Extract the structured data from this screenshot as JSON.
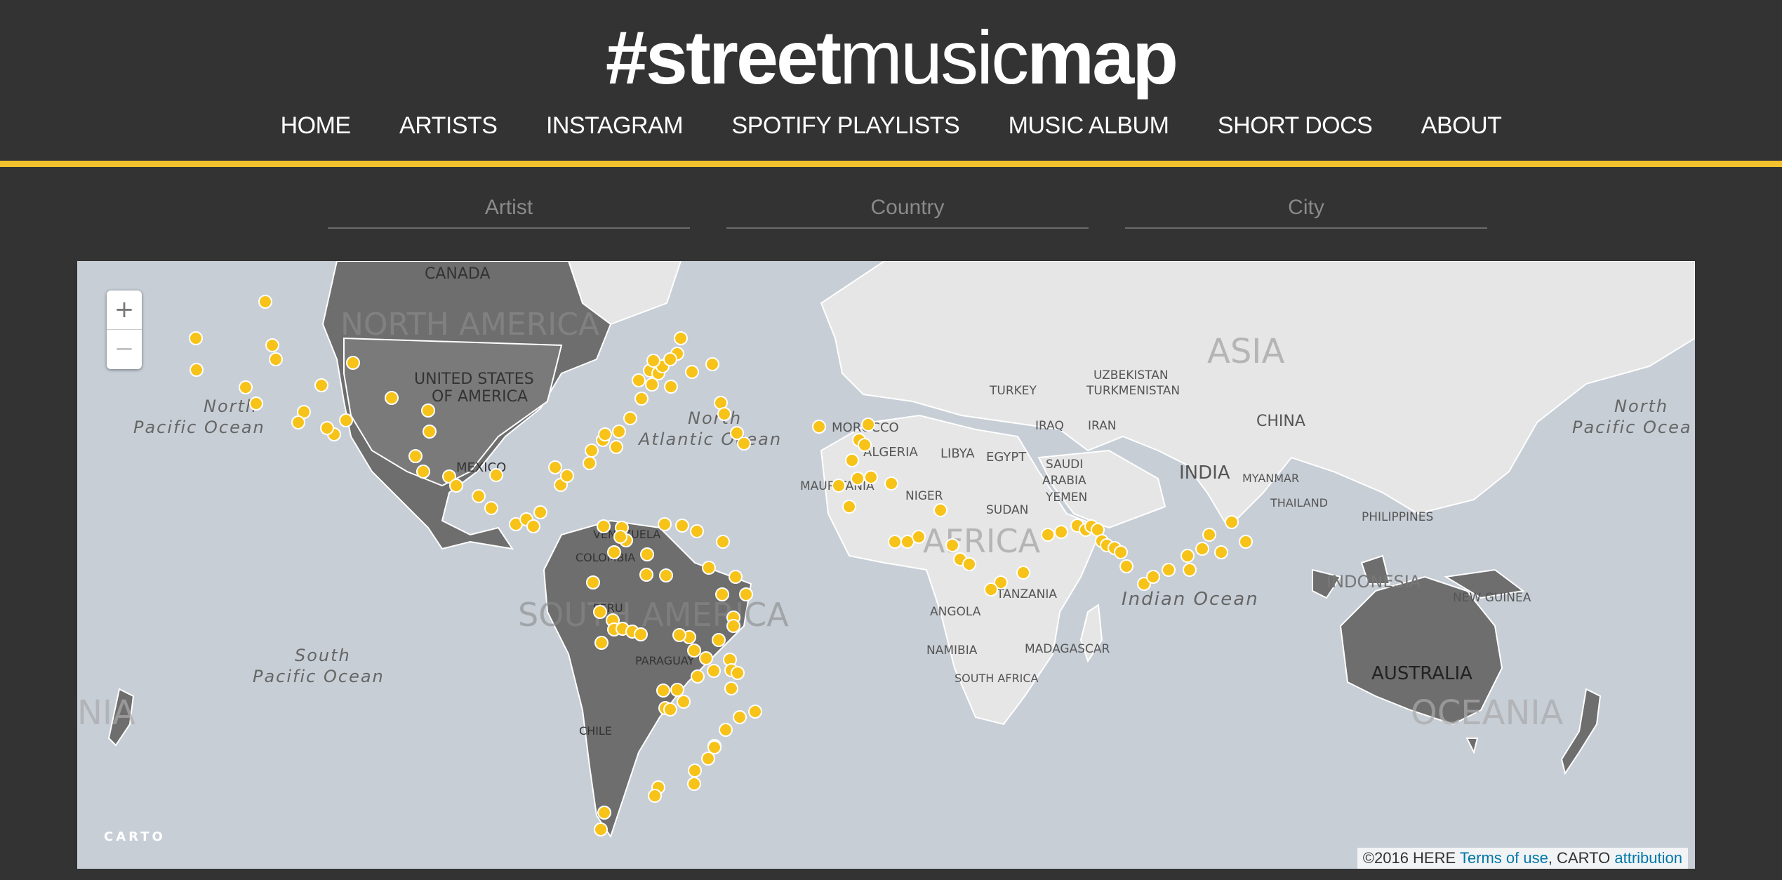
{
  "header": {
    "logo_part1": "#street",
    "logo_part2": "music",
    "logo_part3": "map",
    "nav": [
      "HOME",
      "ARTISTS",
      "INSTAGRAM",
      "SPOTIFY PLAYLISTS",
      "MUSIC ALBUM",
      "SHORT DOCS",
      "ABOUT"
    ]
  },
  "filters": {
    "artist_placeholder": "Artist",
    "country_placeholder": "Country",
    "city_placeholder": "City"
  },
  "map": {
    "zoom_in": "+",
    "zoom_out": "−",
    "carto_logo": "CARTO",
    "attribution_prefix": "©2016 HERE ",
    "terms_link": "Terms of use",
    "attribution_mid": ", CARTO ",
    "attribution_link": "attribution",
    "labels": {
      "canada": "CANADA",
      "north_america": "NORTH AMERICA",
      "usa_1": "UNITED STATES",
      "usa_2": "OF AMERICA",
      "mexico": "MEXICO",
      "north_pacific_1": "North",
      "north_pacific_2": "Pacific Ocean",
      "north_atlantic_1": "North",
      "north_atlantic_2": "Atlantic Ocean",
      "south_pacific_1": "South",
      "south_pacific_2": "Pacific Ocean",
      "south_america": "SOUTH AMERICA",
      "venezuela": "VENEZUELA",
      "colombia": "COLOMBIA",
      "peru": "PERU",
      "paraguay": "PARAGUAY",
      "chile": "CHILE",
      "morocco": "MOROCCO",
      "algeria": "ALGERIA",
      "libya": "LIBYA",
      "egypt": "EGYPT",
      "mauritania": "MAURITANIA",
      "niger": "NIGER",
      "sudan": "SUDAN",
      "africa": "AFRICA",
      "tanzania": "TANZANIA",
      "angola": "ANGOLA",
      "namibia": "NAMIBIA",
      "south_africa": "SOUTH AFRICA",
      "madagascar": "MADAGASCAR",
      "turkey": "TURKEY",
      "iraq": "IRAQ",
      "iran": "IRAN",
      "saudi_1": "SAUDI",
      "saudi_2": "ARABIA",
      "yemen": "YEMEN",
      "uzbekistan": "UZBEKISTAN",
      "turkmenistan": "TURKMENISTAN",
      "asia": "ASIA",
      "china": "CHINA",
      "india": "INDIA",
      "myanmar": "MYANMAR",
      "thailand": "THAILAND",
      "philippines": "PHILIPPINES",
      "indonesia": "INDONESIA",
      "new_guinea": "NEW GUINEA",
      "indian_ocean": "Indian Ocean",
      "australia": "AUSTRALIA",
      "oceania": "OCEANIA",
      "oceania_left": "NIA",
      "north_pacific_r1": "North",
      "north_pacific_r2": "Pacific Ocea"
    }
  },
  "colors": {
    "background": "#333333",
    "accent": "#f2c12e",
    "marker": "#f7c319",
    "water": "#c7ced6",
    "land_light": "#e6e6e6",
    "land_dark": "#6e6e6e"
  }
}
